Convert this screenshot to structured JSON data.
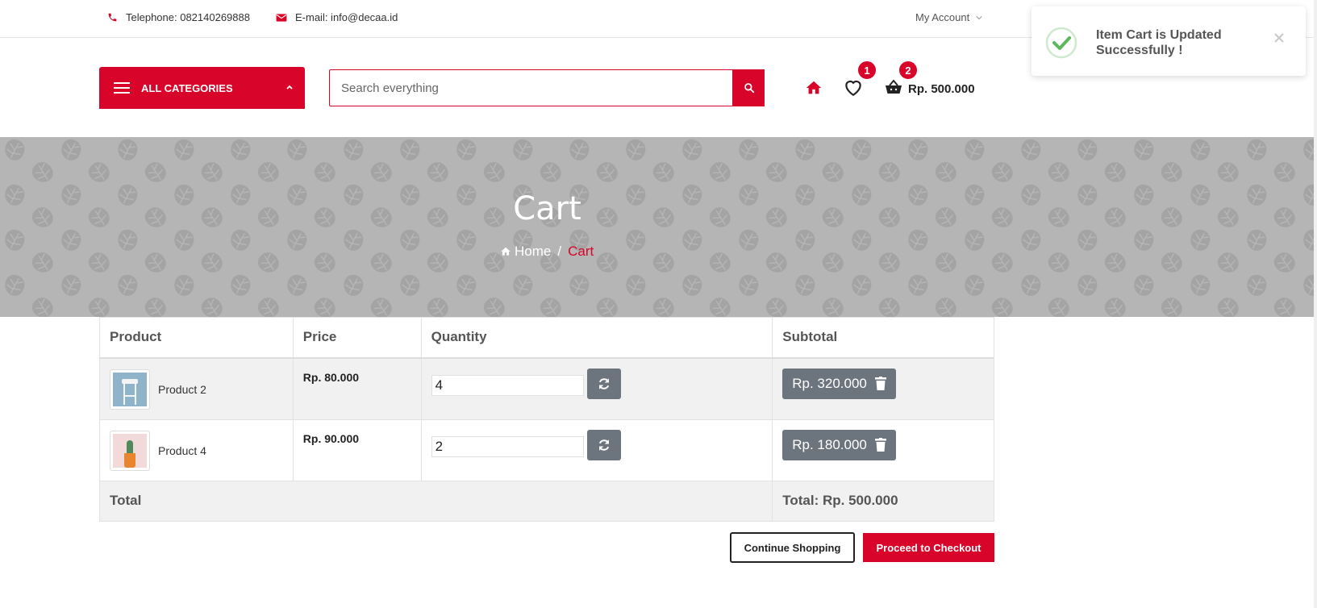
{
  "topbar": {
    "telephone": "Telephone: 082140269888",
    "email": "E-mail: info@decaa.id",
    "account": "My Account"
  },
  "header": {
    "categories_label": "ALL CATEGORIES",
    "search_placeholder": "Search everything",
    "wishlist_count": "1",
    "cart_count": "2",
    "cart_total": "Rp. 500.000"
  },
  "banner": {
    "title": "Cart",
    "breadcrumb_home": "Home",
    "breadcrumb_sep": "/",
    "breadcrumb_current": "Cart"
  },
  "cart": {
    "columns": [
      "Product",
      "Price",
      "Quantity",
      "Subtotal"
    ],
    "items": [
      {
        "name": "Product 2",
        "price": "Rp. 80.000",
        "quantity": "4",
        "subtotal": "Rp. 320.000"
      },
      {
        "name": "Product 4",
        "price": "Rp. 90.000",
        "quantity": "2",
        "subtotal": "Rp. 180.000"
      }
    ],
    "total_label": "Total",
    "total_value": "Total: Rp. 500.000"
  },
  "actions": {
    "continue": "Continue Shopping",
    "checkout": "Proceed to Checkout"
  },
  "toast": {
    "message": "Item Cart is Updated Successfully !"
  },
  "colors": {
    "accent": "#d90429",
    "button_grey": "#6c757d",
    "banner_grey": "#b5b5b5"
  }
}
